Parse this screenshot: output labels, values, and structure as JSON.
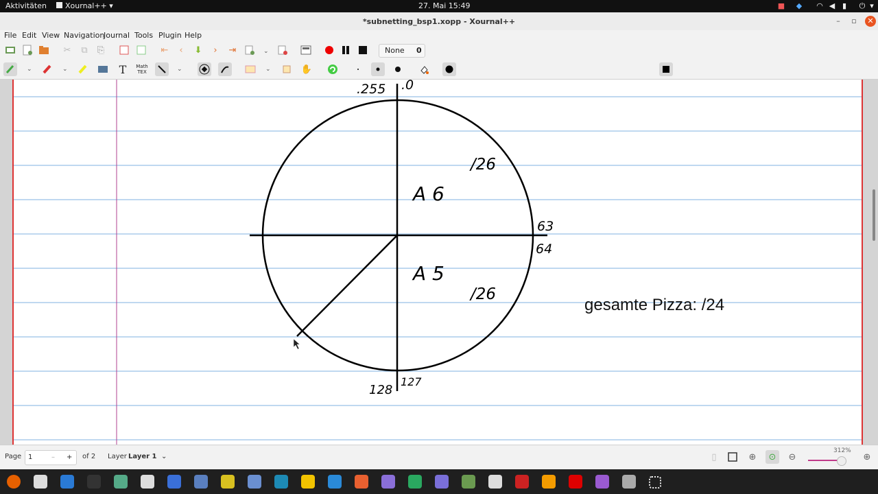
{
  "topbar": {
    "activities": "Aktivitäten",
    "app_menu": "Xournal++",
    "clock": "27. Mai  15:49"
  },
  "window": {
    "title": "*subnetting_bsp1.xopp - Xournal++"
  },
  "menu": {
    "items": [
      "File",
      "Edit",
      "View",
      "Navigation",
      "Journal",
      "Tools",
      "Plugin",
      "Help"
    ]
  },
  "toolbar": {
    "layer_select": "None",
    "layer_number": "0",
    "math_label": "Math TEX",
    "text_tool": "T",
    "colors": [
      "#000000",
      "#008000",
      "#00c0ff",
      "#00c000",
      "#3333cc",
      "#808080",
      "#ff0000",
      "#ff00ff",
      "#ff8000",
      "#ffff00",
      "#ffffff"
    ]
  },
  "drawing": {
    "label_top_left": ".255",
    "label_top_right": ".0",
    "label_quarter_upper": "/26",
    "label_a6": "A 6",
    "label_right_upper": "63",
    "label_right_lower": "64",
    "label_a5": "A 5",
    "label_quarter_lower": "/26",
    "label_bottom_left": "128",
    "label_bottom_right": "127",
    "pizza_text": "gesamte Pizza: /24"
  },
  "statusbar": {
    "page_label": "Page",
    "page_value": "1",
    "page_minus": "–",
    "page_plus": "+",
    "page_of": "of 2",
    "layer_label": "Layer",
    "layer_value": "Layer 1",
    "zoom": "312%"
  },
  "dock": {
    "icons": [
      "firefox-icon",
      "files-icon",
      "writer-icon",
      "terminal-icon",
      "app-icon",
      "settings-icon",
      "notes-icon",
      "virtualbox-icon",
      "graph-icon",
      "network-icon",
      "editor-icon",
      "notes-yellow-icon",
      "vscode-icon",
      "store-icon",
      "browser-icon",
      "app-green-icon",
      "screenshot-icon",
      "app2-icon",
      "xournal-icon",
      "filezilla-icon",
      "puzzle-icon",
      "opera-icon",
      "media-icon",
      "drive-icon",
      "app-grid-icon"
    ]
  }
}
